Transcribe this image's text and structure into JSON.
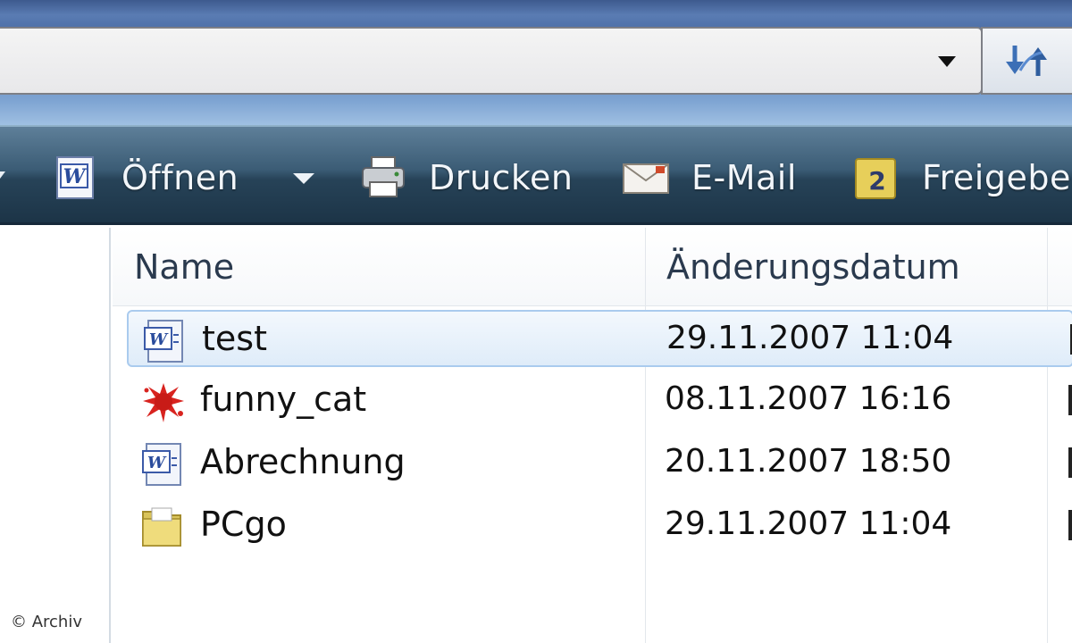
{
  "toolbar": {
    "open_label": "Öffnen",
    "print_label": "Drucken",
    "email_label": "E-Mail",
    "share_label": "Freigebe",
    "share_icon_text": "2"
  },
  "columns": {
    "name": "Name",
    "modified": "Änderungsdatum"
  },
  "files": [
    {
      "name": "test",
      "modified": "29.11.2007 11:04",
      "icon": "word-document-icon",
      "selected": true
    },
    {
      "name": "funny_cat",
      "modified": "08.11.2007 16:16",
      "icon": "splat-image-icon",
      "selected": false
    },
    {
      "name": "Abrechnung",
      "modified": "20.11.2007 18:50",
      "icon": "word-document-icon",
      "selected": false
    },
    {
      "name": "PCgo",
      "modified": "29.11.2007 11:04",
      "icon": "folder-icon",
      "selected": false
    }
  ],
  "watermark": "© Archiv",
  "colors": {
    "toolbar_text": "#f2f6fa",
    "selection_border": "#aacbee",
    "selection_fill": "#dfecf9",
    "folder_yellow": "#e8d36a",
    "splat_red": "#d8231f"
  }
}
